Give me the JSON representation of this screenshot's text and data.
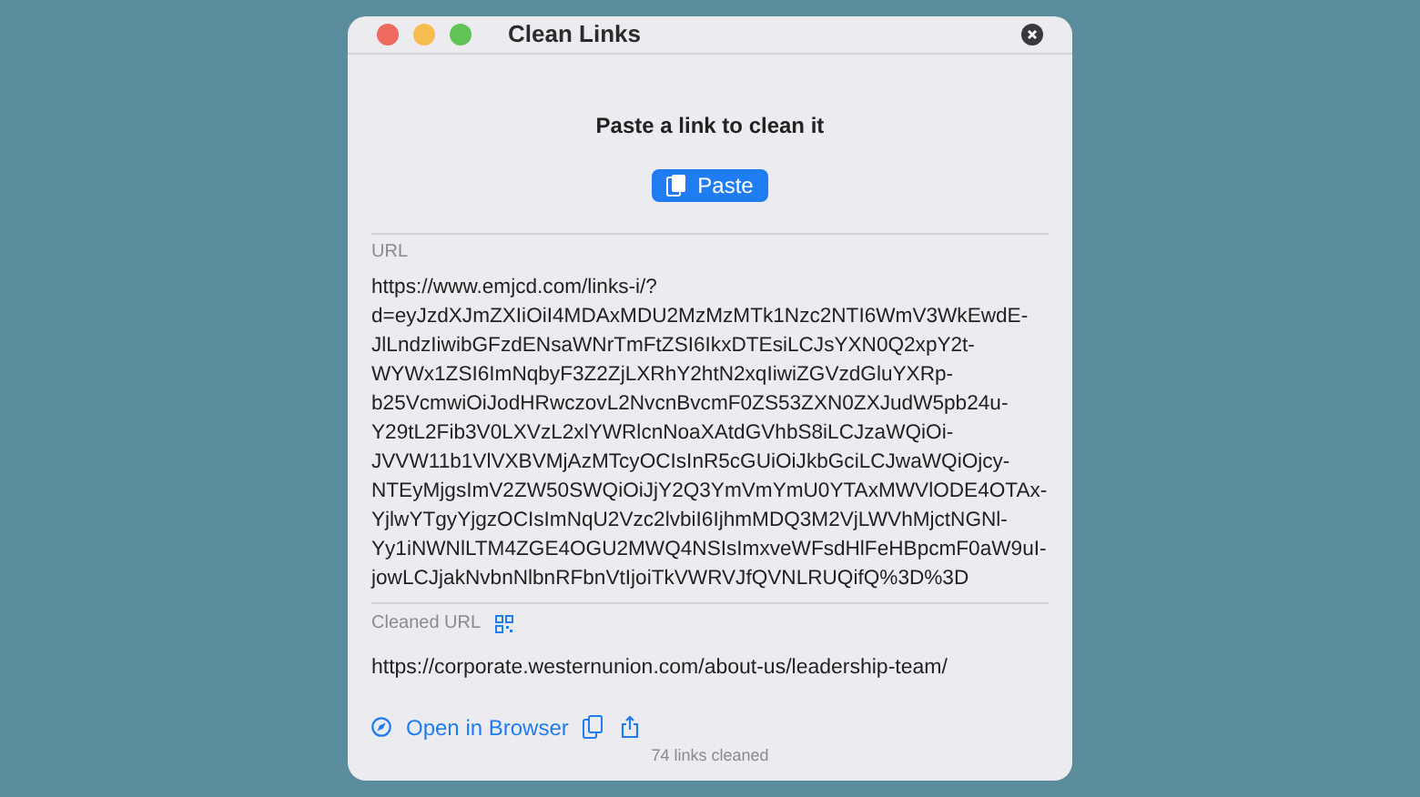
{
  "window": {
    "title": "Clean Links"
  },
  "prompt": "Paste a link to clean it",
  "paste_button": {
    "label": "Paste"
  },
  "url": {
    "label": "URL",
    "lines": [
      "https://www.emjcd.com/links-i/?",
      "d=eyJzdXJmZXIiOiI4MDAxMDU2MzMzMTk1Nzc2NTI6WmV3WkEwdE-",
      "JlLndzIiwibGFzdENsaWNrTmFtZSI6IkxDTEsiLCJsYXN0Q2xpY2t-",
      "WYWx1ZSI6ImNqbyF3Z2ZjLXRhY2htN2xqIiwiZGVzdGluYXRp-",
      "b25VcmwiOiJodHRwczovL2NvcnBvcmF0ZS53ZXN0ZXJudW5pb24u-",
      "Y29tL2Fib3V0LXVzL2xlYWRlcnNoaXAtdGVhbS8iLCJzaWQiOi-",
      "JVVW11b1VlVXBVMjAzMTcyOCIsInR5cGUiOiJkbGciLCJwaWQiOjcy-",
      "NTEyMjgsImV2ZW50SWQiOiJjY2Q3YmVmYmU0YTAxMWVlODE4OTAx-",
      "YjlwYTgyYjgzOCIsImNqU2Vzc2lvbiI6IjhmMDQ3M2VjLWVhMjctNGNl-",
      "Yy1iNWNlLTM4ZGE4OGU2MWQ4NSIsImxveWFsdHlFeHBpcmF0aW9uI-",
      "jowLCJjakNvbnNlbnRFbnVtIjoiTkVWRVJfQVNLRUQifQ%3D%3D"
    ]
  },
  "cleaned_url": {
    "label": "Cleaned URL",
    "value": "https://corporate.westernunion.com/about-us/leadership-team/"
  },
  "actions": {
    "open_label": "Open in Browser"
  },
  "footer": "74 links cleaned"
}
